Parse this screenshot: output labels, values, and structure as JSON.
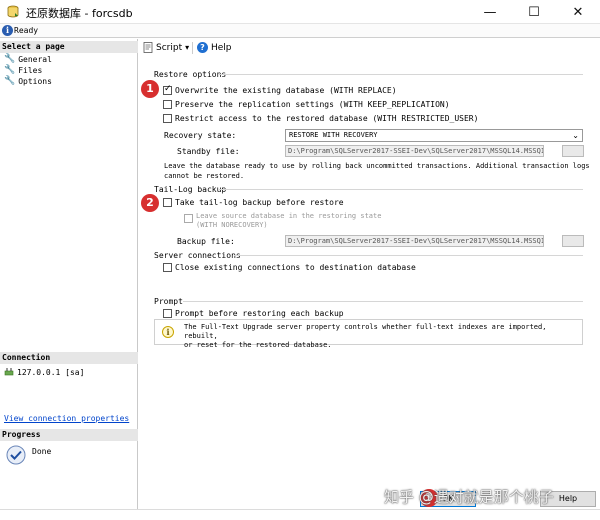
{
  "window": {
    "title": "还原数据库 - forcsdb",
    "minimize_glyph": "—",
    "maximize_glyph": "☐",
    "close_glyph": "✕"
  },
  "status": {
    "icon": "info-icon",
    "text": "Ready"
  },
  "left": {
    "select_page_header": "Select a page",
    "pages": [
      "General",
      "Files",
      "Options"
    ],
    "connection_header": "Connection",
    "connection_server": "127.0.0.1 [sa]",
    "view_connection_link": "View connection properties",
    "progress_header": "Progress",
    "progress_status": "Done"
  },
  "toolbar": {
    "script_label": "Script",
    "script_arrow": "▾",
    "help_label": "Help"
  },
  "restore_options": {
    "title": "Restore options",
    "overwrite": "Overwrite the existing database (WITH REPLACE)",
    "overwrite_checked": true,
    "preserve": "Preserve the replication settings (WITH KEEP_REPLICATION)",
    "restrict": "Restrict access to the restored database (WITH RESTRICTED_USER)",
    "recovery_label": "Recovery state:",
    "recovery_value": "RESTORE WITH RECOVERY",
    "standby_label": "Standby file:",
    "standby_value": "D:\\Program\\SQLServer2017-SSEI-Dev\\SQLServer2017\\MSSQL14.MSSQI",
    "recovery_note_line1": "Leave the database ready to use by rolling back uncommitted transactions. Additional transaction logs",
    "recovery_note_line2": "cannot be restored."
  },
  "tail_log": {
    "title": "Tail-Log backup",
    "take_backup": "Take tail-log backup before restore",
    "leave_source_line1": "Leave source database in the restoring state",
    "leave_source_line2": "(WITH NORECOVERY)",
    "backup_file_label": "Backup file:",
    "backup_file_value": "D:\\Program\\SQLServer2017-SSEI-Dev\\SQLServer2017\\MSSQL14.MSSQI"
  },
  "server_connections": {
    "title": "Server connections",
    "close_existing": "Close existing connections to destination database"
  },
  "prompt": {
    "title": "Prompt",
    "prompt_before": "Prompt before restoring each backup",
    "info_line1": "The Full-Text Upgrade server property controls whether full-text indexes are imported, rebuilt,",
    "info_line2": "or reset for the restored database."
  },
  "markers": [
    "1",
    "2",
    "3"
  ],
  "buttons": {
    "ok": "OK",
    "help": "Help"
  },
  "watermark": "知乎 @遇对就是那个桃子",
  "colors": {
    "marker": "#d72f2f",
    "link": "#0044cc",
    "accent": "#0078d7"
  }
}
